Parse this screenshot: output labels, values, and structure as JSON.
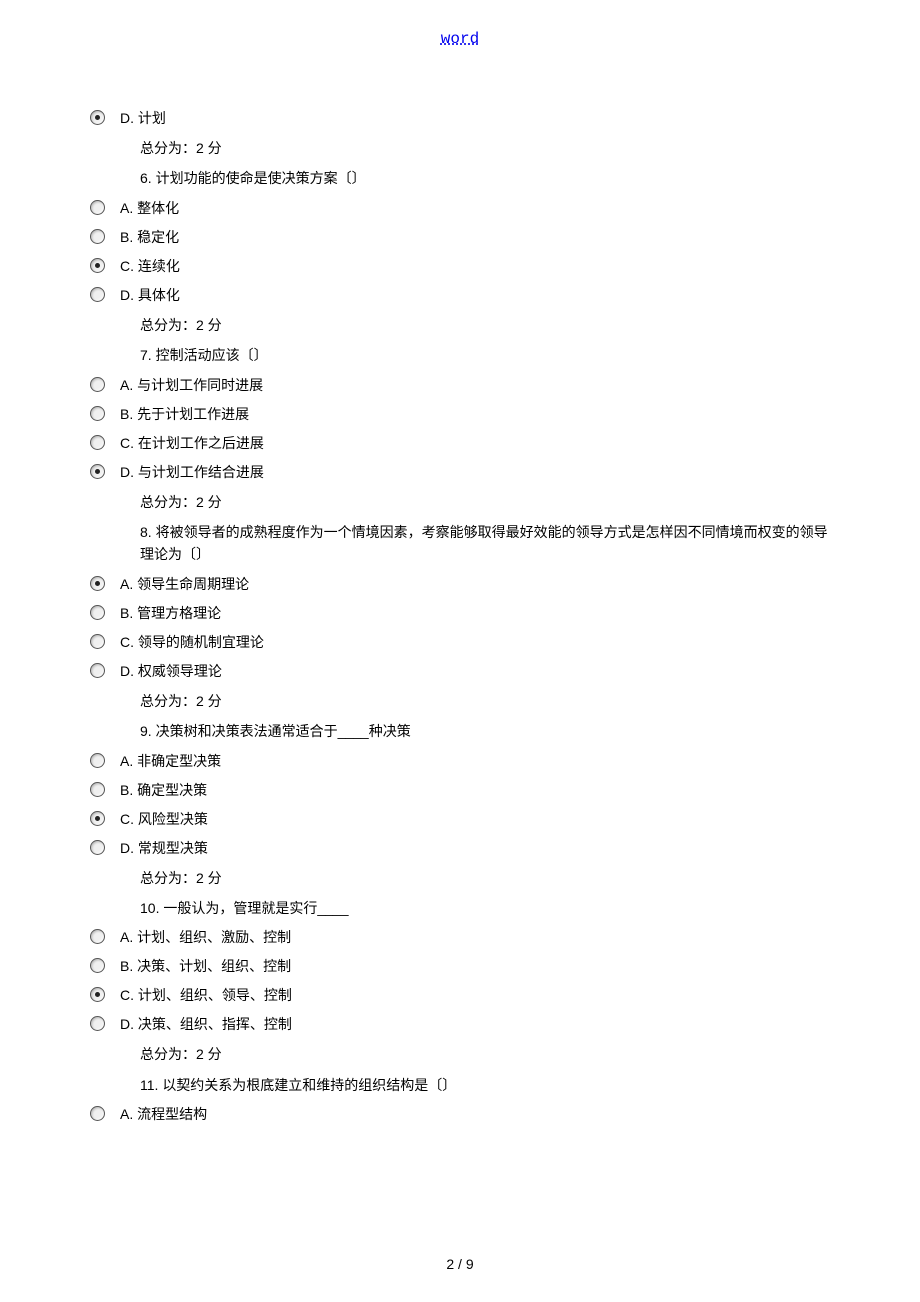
{
  "header": {
    "link_text": "word"
  },
  "footer": {
    "page_number": "2 / 9"
  },
  "score_text": "总分为：2 分",
  "questions": [
    {
      "prepend_option": {
        "letter": "D.",
        "text": " 计划",
        "selected": true
      },
      "show_score_before": true,
      "stem": "6. 计划功能的使命是使决策方案〔〕",
      "options": [
        {
          "letter": "A.",
          "text": " 整体化",
          "selected": false
        },
        {
          "letter": "B.",
          "text": " 稳定化",
          "selected": false
        },
        {
          "letter": "C.",
          "text": " 连续化",
          "selected": true
        },
        {
          "letter": "D.",
          "text": " 具体化",
          "selected": false
        }
      ]
    },
    {
      "show_score_before": true,
      "stem": "7. 控制活动应该〔〕",
      "options": [
        {
          "letter": "A.",
          "text": " 与计划工作同时进展",
          "selected": false
        },
        {
          "letter": "B.",
          "text": " 先于计划工作进展",
          "selected": false
        },
        {
          "letter": "C.",
          "text": " 在计划工作之后进展",
          "selected": false
        },
        {
          "letter": "D.",
          "text": " 与计划工作结合进展",
          "selected": true
        }
      ]
    },
    {
      "show_score_before": true,
      "stem": "8. 将被领导者的成熟程度作为一个情境因素，考察能够取得最好效能的领导方式是怎样因不同情境而权变的领导理论为〔〕",
      "options": [
        {
          "letter": "A.",
          "text": " 领导生命周期理论",
          "selected": true
        },
        {
          "letter": "B.",
          "text": " 管理方格理论",
          "selected": false
        },
        {
          "letter": "C.",
          "text": " 领导的随机制宜理论",
          "selected": false
        },
        {
          "letter": "D.",
          "text": " 权威领导理论",
          "selected": false
        }
      ]
    },
    {
      "show_score_before": true,
      "stem": "9. 决策树和决策表法通常适合于____种决策",
      "options": [
        {
          "letter": "A.",
          "text": " 非确定型决策",
          "selected": false
        },
        {
          "letter": "B.",
          "text": " 确定型决策",
          "selected": false
        },
        {
          "letter": "C.",
          "text": " 风险型决策",
          "selected": true
        },
        {
          "letter": "D.",
          "text": " 常规型决策",
          "selected": false
        }
      ]
    },
    {
      "show_score_before": true,
      "stem": "10. 一般认为，管理就是实行____",
      "options": [
        {
          "letter": "A.",
          "text": " 计划、组织、激励、控制",
          "selected": false
        },
        {
          "letter": "B.",
          "text": " 决策、计划、组织、控制",
          "selected": false
        },
        {
          "letter": "C.",
          "text": " 计划、组织、领导、控制",
          "selected": true
        },
        {
          "letter": "D.",
          "text": " 决策、组织、指挥、控制",
          "selected": false
        }
      ]
    },
    {
      "show_score_before": true,
      "stem": "11. 以契约关系为根底建立和维持的组织结构是〔〕",
      "options": [
        {
          "letter": "A.",
          "text": " 流程型结构",
          "selected": false
        }
      ]
    }
  ]
}
